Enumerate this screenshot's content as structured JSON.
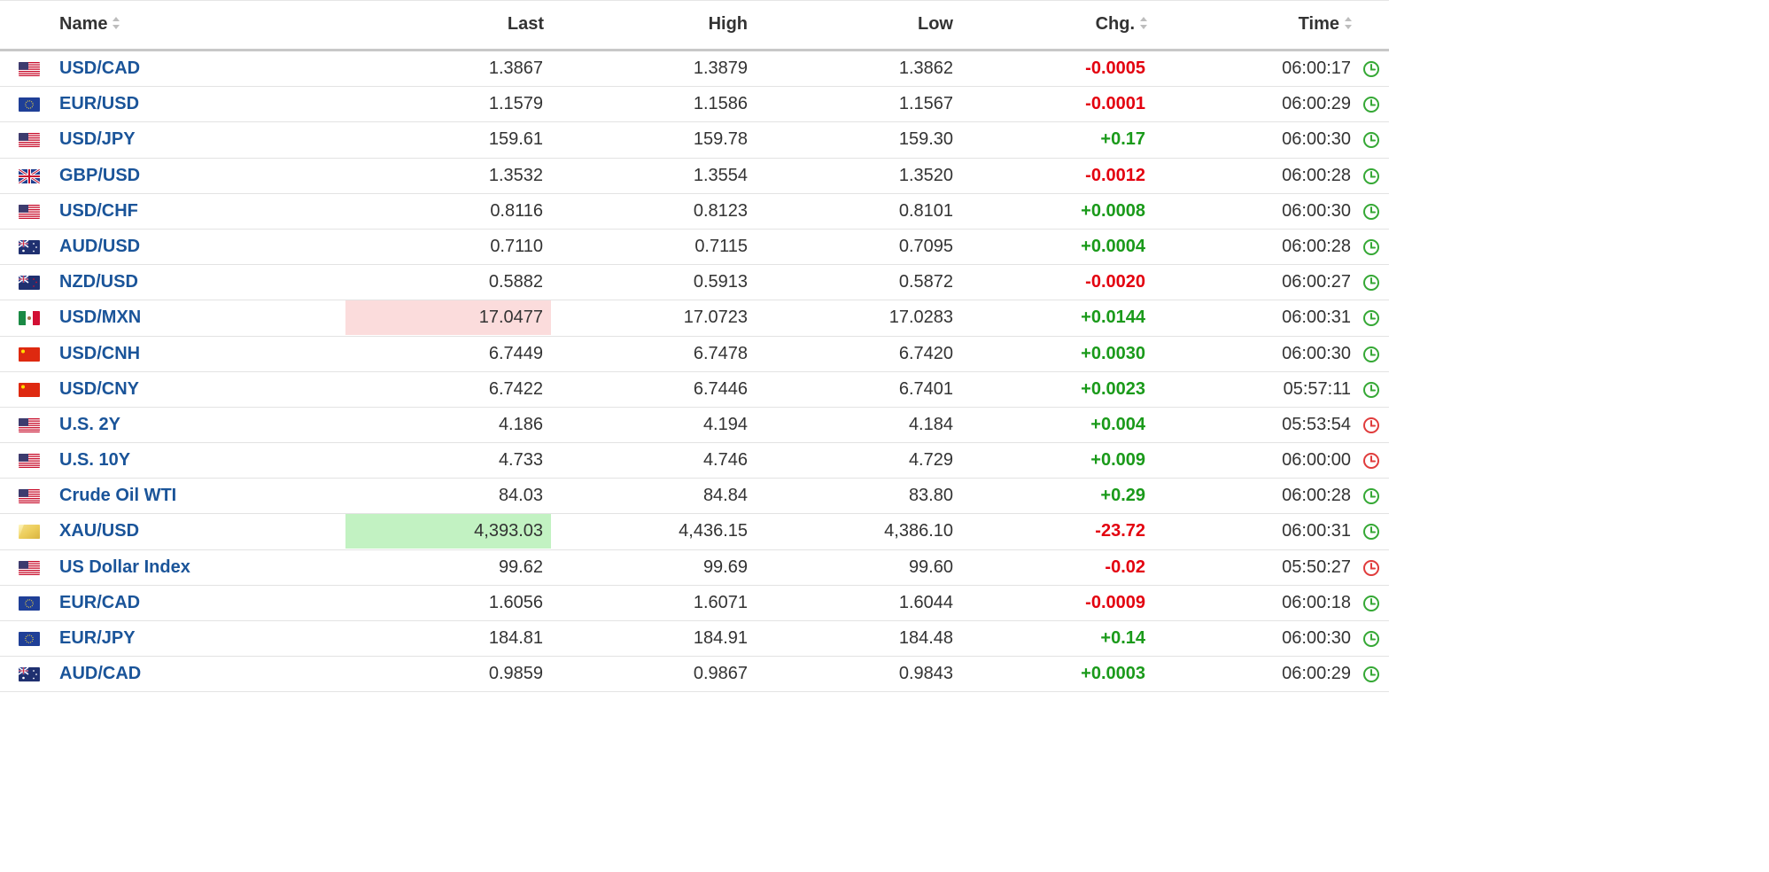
{
  "header": {
    "name": "Name",
    "last": "Last",
    "high": "High",
    "low": "Low",
    "chg": "Chg.",
    "time": "Time"
  },
  "colors": {
    "pos": "#1a9a1a",
    "neg": "#e3000f",
    "link": "#1a5499",
    "clock_green": "#35a835",
    "clock_red": "#e03c3c"
  },
  "rows": [
    {
      "flag": "us",
      "name": "USD/CAD",
      "last": "1.3867",
      "high": "1.3879",
      "low": "1.3862",
      "chg": "-0.0005",
      "dir": "neg",
      "time": "06:00:17",
      "clock": "green",
      "hl": ""
    },
    {
      "flag": "eu",
      "name": "EUR/USD",
      "last": "1.1579",
      "high": "1.1586",
      "low": "1.1567",
      "chg": "-0.0001",
      "dir": "neg",
      "time": "06:00:29",
      "clock": "green",
      "hl": ""
    },
    {
      "flag": "us",
      "name": "USD/JPY",
      "last": "159.61",
      "high": "159.78",
      "low": "159.30",
      "chg": "+0.17",
      "dir": "pos",
      "time": "06:00:30",
      "clock": "green",
      "hl": ""
    },
    {
      "flag": "gb",
      "name": "GBP/USD",
      "last": "1.3532",
      "high": "1.3554",
      "low": "1.3520",
      "chg": "-0.0012",
      "dir": "neg",
      "time": "06:00:28",
      "clock": "green",
      "hl": ""
    },
    {
      "flag": "us",
      "name": "USD/CHF",
      "last": "0.8116",
      "high": "0.8123",
      "low": "0.8101",
      "chg": "+0.0008",
      "dir": "pos",
      "time": "06:00:30",
      "clock": "green",
      "hl": ""
    },
    {
      "flag": "au",
      "name": "AUD/USD",
      "last": "0.7110",
      "high": "0.7115",
      "low": "0.7095",
      "chg": "+0.0004",
      "dir": "pos",
      "time": "06:00:28",
      "clock": "green",
      "hl": ""
    },
    {
      "flag": "nz",
      "name": "NZD/USD",
      "last": "0.5882",
      "high": "0.5913",
      "low": "0.5872",
      "chg": "-0.0020",
      "dir": "neg",
      "time": "06:00:27",
      "clock": "green",
      "hl": ""
    },
    {
      "flag": "mx",
      "name": "USD/MXN",
      "last": "17.0477",
      "high": "17.0723",
      "low": "17.0283",
      "chg": "+0.0144",
      "dir": "pos",
      "time": "06:00:31",
      "clock": "green",
      "hl": "red"
    },
    {
      "flag": "cn",
      "name": "USD/CNH",
      "last": "6.7449",
      "high": "6.7478",
      "low": "6.7420",
      "chg": "+0.0030",
      "dir": "pos",
      "time": "06:00:30",
      "clock": "green",
      "hl": ""
    },
    {
      "flag": "cn",
      "name": "USD/CNY",
      "last": "6.7422",
      "high": "6.7446",
      "low": "6.7401",
      "chg": "+0.0023",
      "dir": "pos",
      "time": "05:57:11",
      "clock": "green",
      "hl": ""
    },
    {
      "flag": "us",
      "name": "U.S. 2Y",
      "last": "4.186",
      "high": "4.194",
      "low": "4.184",
      "chg": "+0.004",
      "dir": "pos",
      "time": "05:53:54",
      "clock": "red",
      "hl": ""
    },
    {
      "flag": "us",
      "name": "U.S. 10Y",
      "last": "4.733",
      "high": "4.746",
      "low": "4.729",
      "chg": "+0.009",
      "dir": "pos",
      "time": "06:00:00",
      "clock": "red",
      "hl": ""
    },
    {
      "flag": "us",
      "name": "Crude Oil WTI",
      "last": "84.03",
      "high": "84.84",
      "low": "83.80",
      "chg": "+0.29",
      "dir": "pos",
      "time": "06:00:28",
      "clock": "green",
      "hl": ""
    },
    {
      "flag": "gold",
      "name": "XAU/USD",
      "last": "4,393.03",
      "high": "4,436.15",
      "low": "4,386.10",
      "chg": "-23.72",
      "dir": "neg",
      "time": "06:00:31",
      "clock": "green",
      "hl": "green"
    },
    {
      "flag": "us",
      "name": "US Dollar Index",
      "last": "99.62",
      "high": "99.69",
      "low": "99.60",
      "chg": "-0.02",
      "dir": "neg",
      "time": "05:50:27",
      "clock": "red",
      "hl": ""
    },
    {
      "flag": "eu",
      "name": "EUR/CAD",
      "last": "1.6056",
      "high": "1.6071",
      "low": "1.6044",
      "chg": "-0.0009",
      "dir": "neg",
      "time": "06:00:18",
      "clock": "green",
      "hl": ""
    },
    {
      "flag": "eu",
      "name": "EUR/JPY",
      "last": "184.81",
      "high": "184.91",
      "low": "184.48",
      "chg": "+0.14",
      "dir": "pos",
      "time": "06:00:30",
      "clock": "green",
      "hl": ""
    },
    {
      "flag": "au",
      "name": "AUD/CAD",
      "last": "0.9859",
      "high": "0.9867",
      "low": "0.9843",
      "chg": "+0.0003",
      "dir": "pos",
      "time": "06:00:29",
      "clock": "green",
      "hl": ""
    }
  ]
}
